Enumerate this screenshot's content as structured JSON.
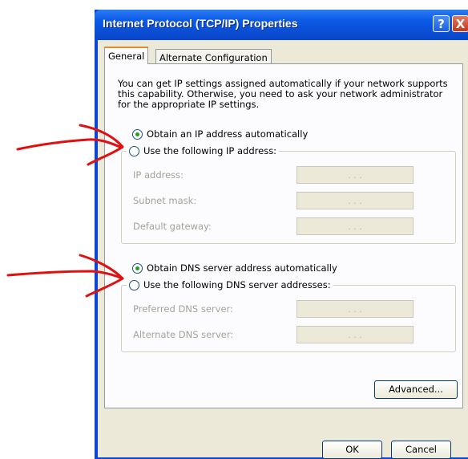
{
  "window": {
    "title": "Internet Protocol (TCP/IP) Properties",
    "help_label": "?",
    "close_label": "X"
  },
  "tabs": [
    {
      "label": "General"
    },
    {
      "label": "Alternate Configuration"
    }
  ],
  "intro_text": "You can get IP settings assigned automatically if your network supports this capability. Otherwise, you need to ask your network administrator for the appropriate IP settings.",
  "ip": {
    "auto_label": "Obtain an IP address automatically",
    "manual_label": "Use the following IP address:",
    "selected": "auto",
    "fields": [
      {
        "label": "IP address:",
        "value": ". . ."
      },
      {
        "label": "Subnet mask:",
        "value": ". . ."
      },
      {
        "label": "Default gateway:",
        "value": ". . ."
      }
    ]
  },
  "dns": {
    "auto_label": "Obtain DNS server address automatically",
    "manual_label": "Use the following DNS server addresses:",
    "selected": "auto",
    "fields": [
      {
        "label": "Preferred DNS server:",
        "value": ". . ."
      },
      {
        "label": "Alternate DNS server:",
        "value": ". . ."
      }
    ]
  },
  "buttons": {
    "advanced": "Advanced...",
    "ok": "OK",
    "cancel": "Cancel"
  },
  "colors": {
    "titlebar": "#0a4fd6",
    "dialog_bg": "#ece9d8",
    "annotation": "#e01010"
  },
  "icons": {
    "help": "question-mark",
    "close": "x-mark",
    "annotation": "hand-drawn-arrow"
  }
}
